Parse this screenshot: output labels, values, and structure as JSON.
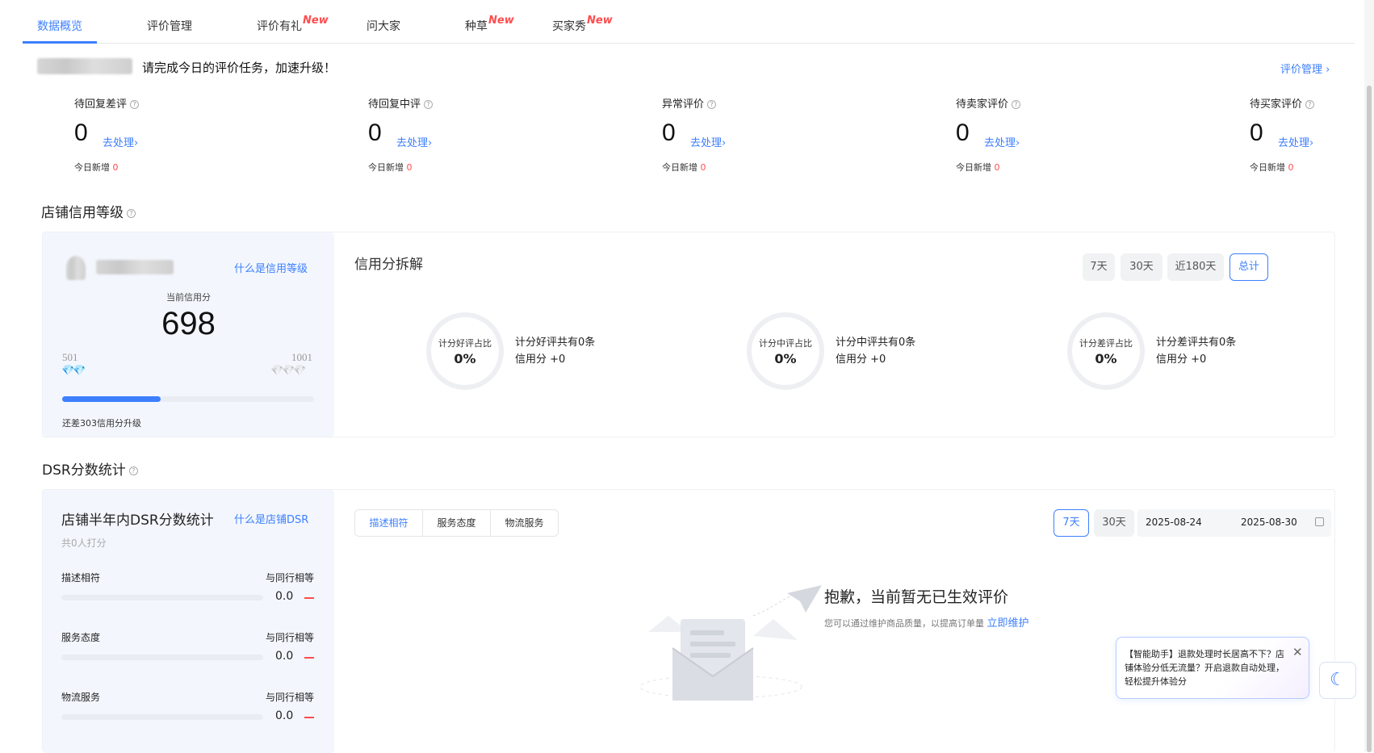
{
  "tabs": [
    {
      "label": "数据概览",
      "new": ""
    },
    {
      "label": "评价管理",
      "new": ""
    },
    {
      "label": "评价有礼",
      "new": "New"
    },
    {
      "label": "问大家",
      "new": ""
    },
    {
      "label": "种草",
      "new": "New"
    },
    {
      "label": "买家秀",
      "new": "New"
    }
  ],
  "banner": {
    "text": "请完成今日的评价任务，加速升级！",
    "link": "评价管理"
  },
  "stats": [
    {
      "title": "待回复差评",
      "value": "0",
      "action": "去处理",
      "today_label": "今日新增",
      "today_value": "0"
    },
    {
      "title": "待回复中评",
      "value": "0",
      "action": "去处理",
      "today_label": "今日新增",
      "today_value": "0"
    },
    {
      "title": "异常评价",
      "value": "0",
      "action": "去处理",
      "today_label": "今日新增",
      "today_value": "0"
    },
    {
      "title": "待卖家评价",
      "value": "0",
      "action": "去处理",
      "today_label": "今日新增",
      "today_value": "0"
    },
    {
      "title": "待买家评价",
      "value": "0",
      "action": "去处理",
      "today_label": "今日新增",
      "today_value": "0"
    }
  ],
  "credit": {
    "section_title": "店铺信用等级",
    "what_link": "什么是信用等级",
    "score_label": "当前信用分",
    "score": "698",
    "min": "501",
    "max": "1001",
    "progress_fraction": 0.39,
    "gap_text": "还差303信用分升级",
    "breakdown_title": "信用分拆解",
    "ranges": [
      "7天",
      "30天",
      "近180天",
      "总计"
    ],
    "active_range": 3,
    "rings": [
      {
        "label": "计分好评占比",
        "pct": "0%",
        "line1": "计分好评共有0条",
        "line2": "信用分 +0"
      },
      {
        "label": "计分中评占比",
        "pct": "0%",
        "line1": "计分中评共有0条",
        "line2": "信用分 +0"
      },
      {
        "label": "计分差评占比",
        "pct": "0%",
        "line1": "计分差评共有0条",
        "line2": "信用分 +0"
      }
    ]
  },
  "dsr": {
    "section_title": "DSR分数统计",
    "panel_title": "店铺半年内DSR分数统计",
    "what_link": "什么是店铺DSR",
    "raters": "共0人打分",
    "compare_label": "与同行相等",
    "items": [
      {
        "name": "描述相符",
        "score": "0.0"
      },
      {
        "name": "服务态度",
        "score": "0.0"
      },
      {
        "name": "物流服务",
        "score": "0.0"
      }
    ],
    "segments": [
      "描述相符",
      "服务态度",
      "物流服务"
    ],
    "ranges": [
      "7天",
      "30天"
    ],
    "date_start": "2025-08-24",
    "date_end": "2025-08-30",
    "empty_title": "抱歉，当前暂无已生效评价",
    "empty_desc": "您可以通过维护商品质量，以提高订单量",
    "empty_link": "立即维护"
  },
  "assistant": {
    "text": "【智能助手】退款处理时长居高不下？店铺体验分低无流量？开启退款自动处理，轻松提升体验分"
  },
  "colors": {
    "accent": "#3d7fff",
    "danger": "#ff4d4f",
    "panel": "#f3f7fd"
  }
}
